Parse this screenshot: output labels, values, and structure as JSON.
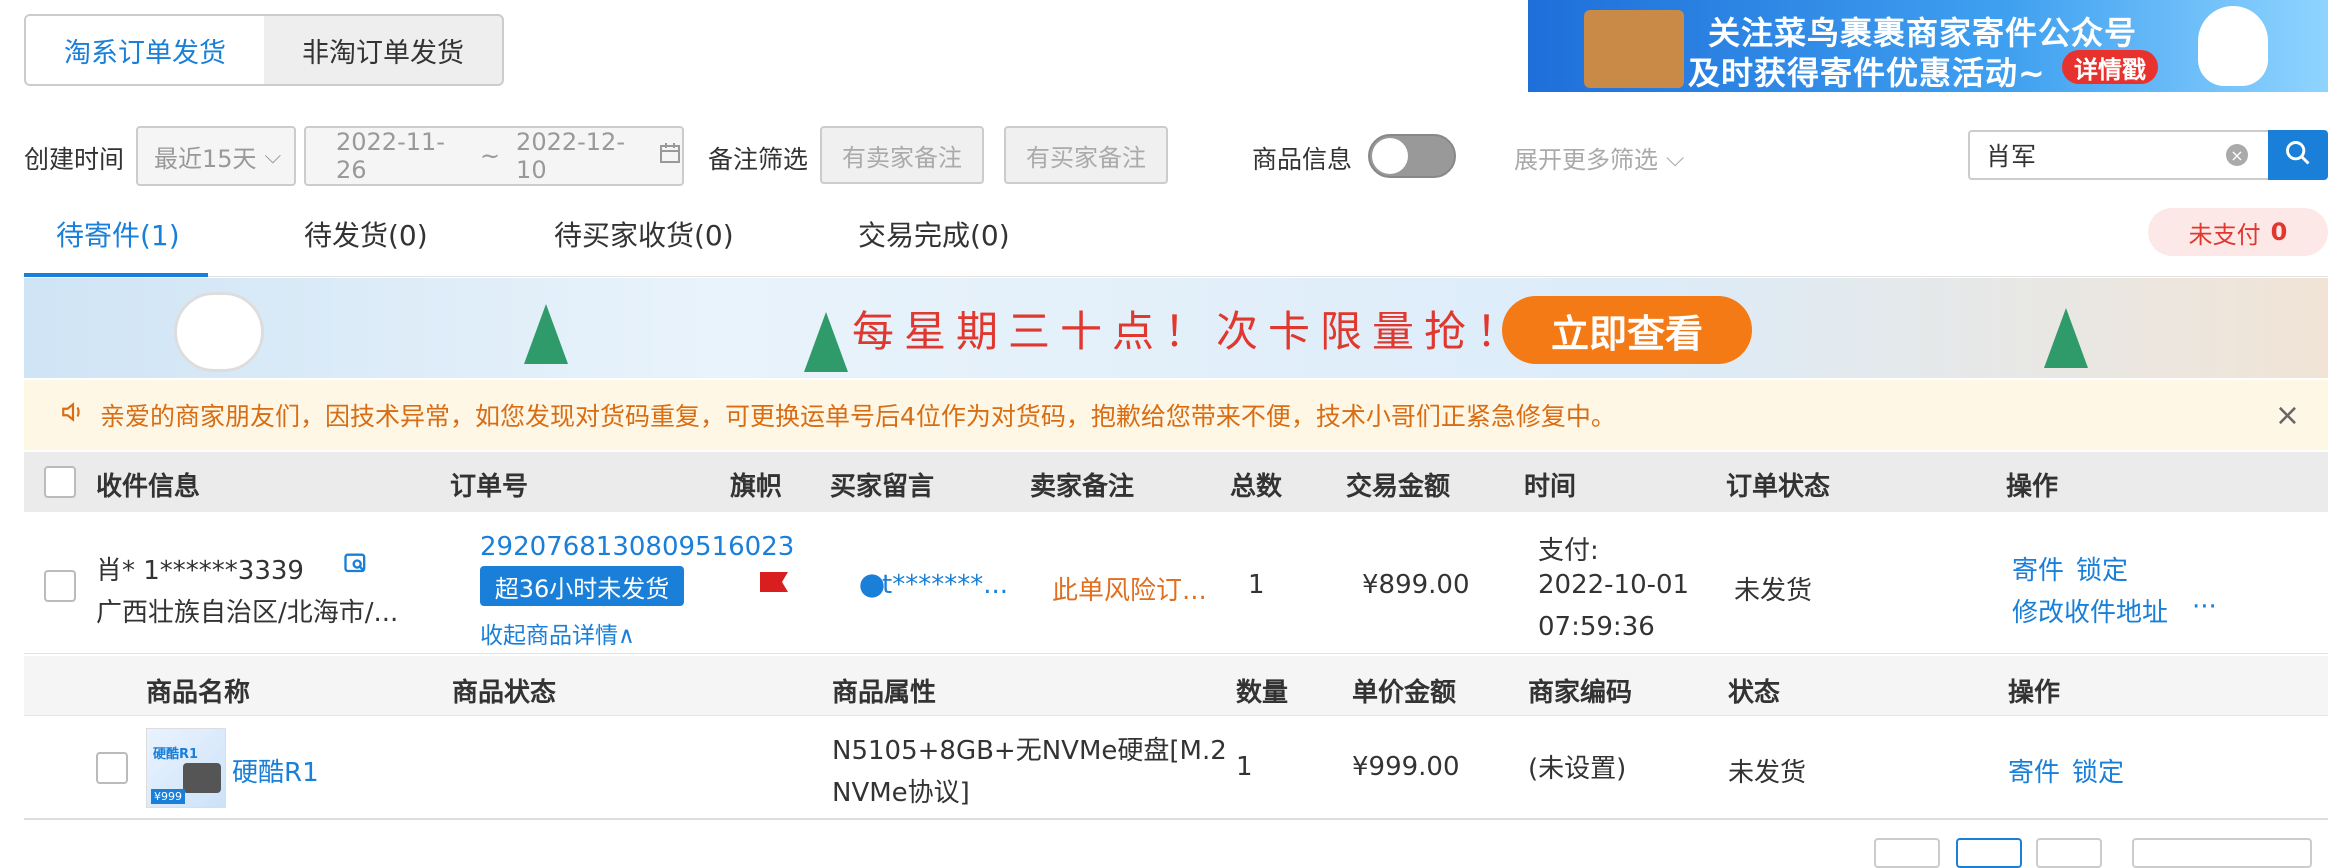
{
  "top_tabs": {
    "taobao": "淘系订单发货",
    "non_taobao": "非淘订单发货"
  },
  "ad_banner": {
    "line1": "关注菜鸟裹裹商家寄件公众号",
    "line2": "及时获得寄件优惠活动~",
    "cta": "详情戳"
  },
  "filters": {
    "create_time_label": "创建时间",
    "range_select": "最近15天",
    "date_start": "2022-11-26",
    "date_sep": "~",
    "date_end": "2022-12-10",
    "remark_label": "备注筛选",
    "seller_remark_btn": "有卖家备注",
    "buyer_remark_btn": "有买家备注",
    "product_info_label": "商品信息",
    "more_filters": "展开更多筛选",
    "search_value": "肖军"
  },
  "status_tabs": [
    {
      "label": "待寄件(1)"
    },
    {
      "label": "待发货(0)"
    },
    {
      "label": "待买家收货(0)"
    },
    {
      "label": "交易完成(0)"
    }
  ],
  "unpaid": {
    "label": "未支付",
    "count": "0"
  },
  "promo": {
    "text": "每星期三十点！次卡限量抢！",
    "button": "立即查看"
  },
  "notice": {
    "text": "亲爱的商家朋友们，因技术异常，如您发现对货码重复，可更换运单号后4位作为对货码，抱歉给您带来不便，技术小哥们正紧急修复中。",
    "close": "×"
  },
  "table_headers": [
    "收件信息",
    "订单号",
    "旗帜",
    "买家留言",
    "卖家备注",
    "总数",
    "交易金额",
    "时间",
    "订单状态",
    "操作"
  ],
  "order": {
    "receiver_name_phone": "肖* 1******3339",
    "receiver_address": "广西壮族自治区/北海市/...",
    "order_no": "2920768130809516023",
    "overdue_badge": "超36小时未发货",
    "collapse_link": "收起商品详情∧",
    "buyer_message": "t*******...",
    "seller_remark": "此单风险订...",
    "total": "1",
    "amount": "¥899.00",
    "time_label": "支付:",
    "time_date": "2022-10-01",
    "time_clock": "07:59:36",
    "status": "未发货",
    "op_send": "寄件",
    "op_lock": "锁定",
    "op_modify": "修改收件地址",
    "op_more": "···"
  },
  "item_headers": [
    "商品名称",
    "商品状态",
    "商品属性",
    "数量",
    "单价金额",
    "商家编码",
    "状态",
    "操作"
  ],
  "item": {
    "name": "硬酷R1",
    "status": "",
    "attr_line1": "N5105+8GB+无NVMe硬盘[M.2",
    "attr_line2": "NVMe协议]",
    "qty": "1",
    "price": "¥999.00",
    "merchant_code": "(未设置)",
    "state": "未发货",
    "op_send": "寄件",
    "op_lock": "锁定",
    "img_brand": "硬酷R1",
    "img_price": "¥999"
  },
  "colors": {
    "accent": "#1a7fd8",
    "warning": "#d86d13",
    "danger": "#e0372e"
  },
  "icons": [
    "calendar-icon",
    "chevron-down-icon",
    "clear-icon",
    "search-icon",
    "speaker-icon",
    "close-icon",
    "flag-icon",
    "chat-icon",
    "copy-icon"
  ]
}
